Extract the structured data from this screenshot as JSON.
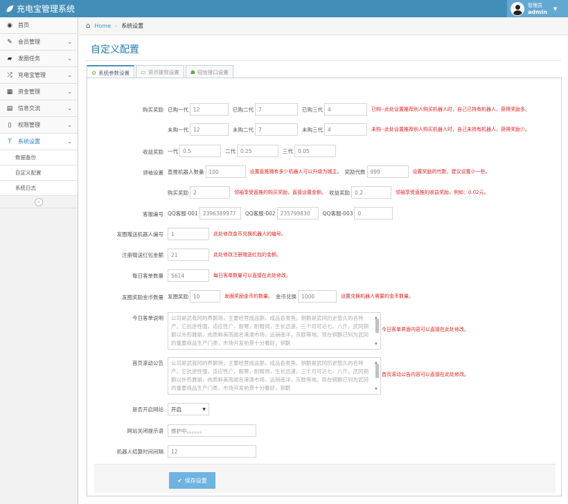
{
  "app": {
    "title": "充电宝管理系统"
  },
  "user": {
    "role": "管理员",
    "name": "admin"
  },
  "sidebar": {
    "items": [
      {
        "icon": "tachometer-icon",
        "glyph": "◉",
        "label": "首页"
      },
      {
        "icon": "pencil-square-icon",
        "glyph": "✎",
        "label": "会员管理"
      },
      {
        "icon": "book-icon",
        "glyph": "▰",
        "label": "发圈任务"
      },
      {
        "icon": "random-icon",
        "glyph": "⤮",
        "label": "充电宝管理"
      },
      {
        "icon": "calendar-icon",
        "glyph": "▦",
        "label": "资金管理"
      },
      {
        "icon": "list-alt-icon",
        "glyph": "▤",
        "label": "信息交流"
      },
      {
        "icon": "file-icon",
        "glyph": "▯",
        "label": "权限管理"
      },
      {
        "icon": "text-width-icon",
        "glyph": "T",
        "label": "系统设置"
      }
    ],
    "subitems": [
      "数据备份",
      "自定义配置",
      "系统日志"
    ],
    "collapse_glyph": "«"
  },
  "breadcrumb": {
    "home": "Home",
    "current": "系统设置"
  },
  "page": {
    "title": "自定义配置"
  },
  "tabs": [
    {
      "label": "系统参数设置",
      "glyph": "⚙"
    },
    {
      "label": "货币提现设置",
      "glyph": "▭"
    },
    {
      "label": "短信接口设置",
      "glyph": "☗"
    }
  ],
  "form": {
    "purchase_reward": {
      "label": "购买奖励",
      "bought": {
        "l1": "已购一代",
        "v1": "12",
        "l2": "已购二代",
        "v2": "7",
        "l3": "已购三代",
        "v3": "4",
        "hint": "已购--此处设置推荐别人购买机器人时，自己已持有机器人，获得奖励多。"
      },
      "unbought": {
        "l1": "未购一代",
        "v1": "12",
        "l2": "未购二代",
        "v2": "7",
        "l3": "未购三代",
        "v3": "4",
        "hint": "未购--此处设置推荐别人购买机器人时，自己未持有机器人，获得奖励少。"
      }
    },
    "income_reward": {
      "label": "收益奖励",
      "l1": "一代",
      "v1": "0.5",
      "l2": "二代",
      "v2": "0.25",
      "l3": "三代",
      "v3": "0.05"
    },
    "leader": {
      "label": "领袖设置",
      "direct_label": "直推机器人数量",
      "direct_value": "100",
      "direct_hint": "设置直推拥有多少机器人可以升级为城主。",
      "gen_label": "奖励代数",
      "gen_value": "999",
      "gen_hint": "设置奖励的代数，建议设置小一些。",
      "buy_label": "购买奖励",
      "buy_value": "2",
      "buy_hint": "领袖享受直推的购买奖励，直接设置金额。",
      "income_label": "收益奖励",
      "income_value": "0.2",
      "income_hint": "领袖享受直推的收益奖励，例如：0.02元。"
    },
    "service": {
      "label": "客服编号",
      "l1": "QQ客服-001",
      "v1": "2396389977",
      "l2": "QQ客服-002",
      "v2": "235799830",
      "l3": "QQ客服-003",
      "v3": "0"
    },
    "gift_robot": {
      "label": "发圈赠送机器人编号",
      "value": "1",
      "hint": "此处修改金币兑换机器人的编号。"
    },
    "register_gift": {
      "label": "注册赠送红包金额",
      "value": "21",
      "hint": "此处修改注册赠送红包的金额。"
    },
    "daily_orders": {
      "label": "每日客单数量",
      "value": "5614",
      "hint": "每日客单数量可以直接在此处修改。"
    },
    "circle_gold": {
      "label": "发圈奖励金币数量",
      "l1": "发圈奖励",
      "v1": "10",
      "hint1": "发圈奖励金币的数量。",
      "l2": "金币兑换",
      "v2": "1000",
      "hint2": "设置兑换机器人需要的金币数量。"
    },
    "daily_desc": {
      "label": "今日客单说明",
      "text": "公司是武我冈的养鹅场，主要经营成品鹅，成品各类鱼。铜鹅是武冈历史悠久的名特产。它抗逆性强，适应性广，耐寒，耐粗饲，生长迅速，三个月可达七、八斤。武冈铜鹅以外形雅丽，肉质鲜美而闻名港澳市场，远销南洋，东欧等地。现在铜鹅已列为武冈的重要商品生产门类，市场开发前景十分看好，铜鹅",
      "hint": "今日客单界面内容可以直接在此处修改。"
    },
    "scroll_notice": {
      "label": "首页滚动公告",
      "text": "公司是武我冈的养鹅场，主要经营成品鹅，成品各类鱼。铜鹅是武冈历史悠久的名特产。它抗逆性强，适应性广，耐寒，耐粗饲，生长迅速，三个月可达七、八斤。武冈铜鹅以外形雅丽，肉质鲜美而闻名港澳市场，远销南洋，东欧等地。现在铜鹅已列为武冈的重要商品生产门类，市场开发前景十分看好，铜鹅",
      "hint": "首页滚动公告内容可以直接在此处修改。"
    },
    "site_open": {
      "label": "是否开启网站",
      "value": "开启"
    },
    "close_tip": {
      "label": "网站关闭提示语",
      "placeholder": "维护中。。。。。。"
    },
    "settle_interval": {
      "label": "机器人结算时间间隔",
      "value": "12"
    },
    "save_label": "保存设置"
  }
}
